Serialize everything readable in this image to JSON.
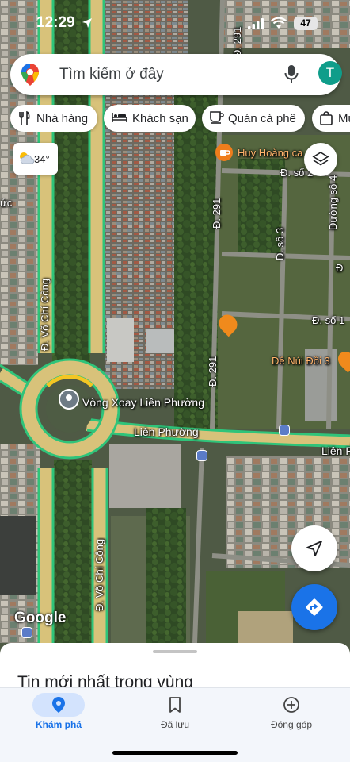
{
  "status_bar": {
    "time": "12:29",
    "battery": "47"
  },
  "search": {
    "placeholder": "Tìm kiếm ở đây",
    "account_initial": "T"
  },
  "chips": [
    {
      "label": "Nhà hàng",
      "icon": "fork-knife-icon"
    },
    {
      "label": "Khách sạn",
      "icon": "bed-icon"
    },
    {
      "label": "Quán cà phê",
      "icon": "coffee-icon"
    },
    {
      "label": "Mu",
      "icon": "shopping-bag-icon"
    }
  ],
  "weather": {
    "temperature": "34°",
    "icon": "partly-cloudy-icon"
  },
  "map": {
    "attribution": "Google",
    "labels": {
      "road_vo_chi_cong_upper": "Đ. Võ Chí Công",
      "road_vo_chi_cong_lower": "Đ. Võ Chí Công",
      "roundabout": "Vòng Xoay Liên Phường",
      "lien_phuong": "Liên Phường",
      "lien_phuong_east": "Liên P",
      "d291_top": "Đ. 291",
      "d291_mid": "Đ. 291",
      "d291_low": "Đ. 291",
      "so2": "Đ. số 2",
      "so3": "Đ. số 3",
      "so4": "Đường số 4",
      "so1": "Đ. số 1",
      "d_cut": "Đ",
      "uc": "ức",
      "huy_hoang": "Huy Hoàng ca",
      "de_nui": "Dê Núi Đồi 3"
    },
    "colors": {
      "traffic_green": "#2fc47a",
      "road_tan": "#d8c27a",
      "cafe_orange": "#ef7d1c",
      "poi_restaurant_orange": "#f08a1c",
      "transit_blue": "#5b7cc8"
    }
  },
  "sheet": {
    "title": "Tin mới nhất trong vùng"
  },
  "nav": [
    {
      "label": "Khám phá",
      "icon": "explore-pin-icon",
      "active": true
    },
    {
      "label": "Đã lưu",
      "icon": "bookmark-icon",
      "active": false
    },
    {
      "label": "Đóng góp",
      "icon": "add-circle-icon",
      "active": false
    }
  ]
}
